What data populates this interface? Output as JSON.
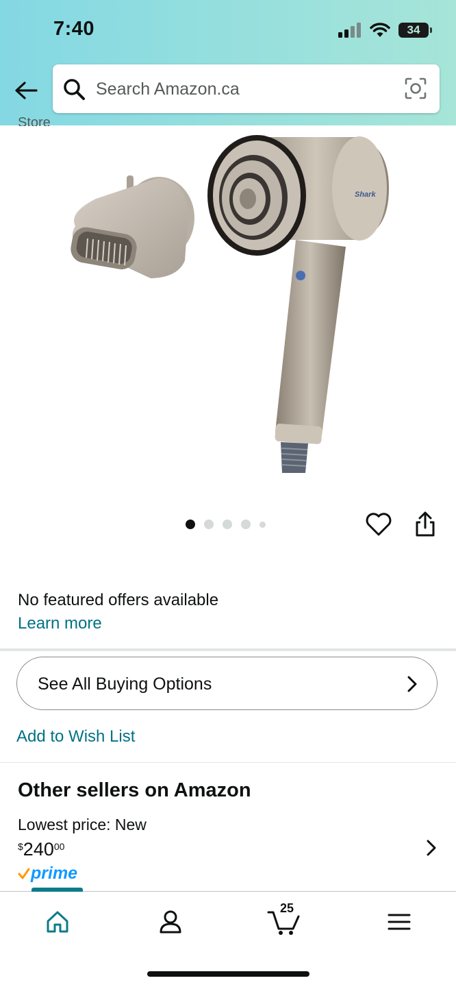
{
  "status_bar": {
    "time": "7:40",
    "battery": "34"
  },
  "search": {
    "placeholder": "Search Amazon.ca"
  },
  "product": {
    "partial_text_top": "Store",
    "brand_mark": "Shark",
    "image_count": 5,
    "active_image": 1
  },
  "offers": {
    "no_offers_text": "No featured offers available",
    "learn_more": "Learn more"
  },
  "actions": {
    "see_all_buying": "See All Buying Options",
    "add_to_wishlist": "Add to Wish List"
  },
  "other_sellers": {
    "title": "Other sellers on Amazon",
    "lowest_price_label": "Lowest price: New",
    "price_symbol": "$",
    "price_whole": "240",
    "price_fraction": "00",
    "prime_label": "prime"
  },
  "bottom_nav": {
    "cart_count": "25",
    "items": [
      "home-icon",
      "account-icon",
      "cart-icon",
      "menu-icon"
    ],
    "active": "home"
  },
  "colors": {
    "header_gradient_start": "#84d8e3",
    "header_gradient_end": "#a6e5d8",
    "link": "#007185",
    "prime_blue": "#1399ff",
    "prime_check": "#ff9900",
    "nav_active": "#0d7b8a"
  }
}
